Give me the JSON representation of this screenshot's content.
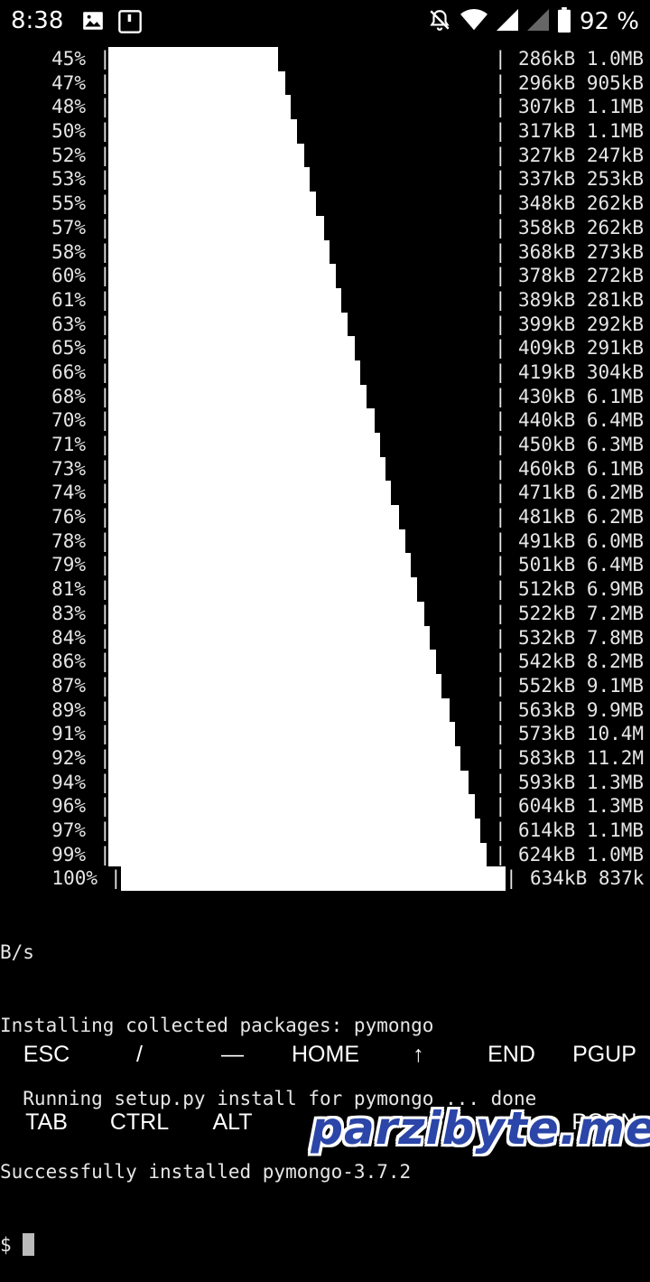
{
  "status_bar": {
    "time": "8:38",
    "left_icons": [
      "image-icon",
      "notification-square-icon"
    ],
    "right_icons": [
      "bell-off-icon",
      "wifi-icon",
      "signal-icon",
      "signal-icon-2",
      "battery-icon"
    ],
    "battery": "92 %"
  },
  "terminal": {
    "progress_rows": [
      {
        "pct": "45%",
        "fraction": 0.44,
        "stats": "286kB 1.0MB"
      },
      {
        "pct": "47%",
        "fraction": 0.458,
        "stats": "296kB 905kB"
      },
      {
        "pct": "48%",
        "fraction": 0.472,
        "stats": "307kB 1.1MB"
      },
      {
        "pct": "50%",
        "fraction": 0.488,
        "stats": "317kB 1.1MB"
      },
      {
        "pct": "52%",
        "fraction": 0.508,
        "stats": "327kB 247kB"
      },
      {
        "pct": "53%",
        "fraction": 0.522,
        "stats": "337kB 253kB"
      },
      {
        "pct": "55%",
        "fraction": 0.538,
        "stats": "348kB 262kB"
      },
      {
        "pct": "57%",
        "fraction": 0.558,
        "stats": "358kB 262kB"
      },
      {
        "pct": "58%",
        "fraction": 0.572,
        "stats": "368kB 273kB"
      },
      {
        "pct": "60%",
        "fraction": 0.588,
        "stats": "378kB 272kB"
      },
      {
        "pct": "61%",
        "fraction": 0.602,
        "stats": "389kB 281kB"
      },
      {
        "pct": "63%",
        "fraction": 0.618,
        "stats": "399kB 292kB"
      },
      {
        "pct": "65%",
        "fraction": 0.638,
        "stats": "409kB 291kB"
      },
      {
        "pct": "66%",
        "fraction": 0.652,
        "stats": "419kB 304kB"
      },
      {
        "pct": "68%",
        "fraction": 0.668,
        "stats": "430kB 6.1MB"
      },
      {
        "pct": "70%",
        "fraction": 0.688,
        "stats": "440kB 6.4MB"
      },
      {
        "pct": "71%",
        "fraction": 0.702,
        "stats": "450kB 6.3MB"
      },
      {
        "pct": "73%",
        "fraction": 0.718,
        "stats": "460kB 6.1MB"
      },
      {
        "pct": "74%",
        "fraction": 0.732,
        "stats": "471kB 6.2MB"
      },
      {
        "pct": "76%",
        "fraction": 0.752,
        "stats": "481kB 6.2MB"
      },
      {
        "pct": "78%",
        "fraction": 0.768,
        "stats": "491kB 6.0MB"
      },
      {
        "pct": "79%",
        "fraction": 0.782,
        "stats": "501kB 6.4MB"
      },
      {
        "pct": "81%",
        "fraction": 0.798,
        "stats": "512kB 6.9MB"
      },
      {
        "pct": "83%",
        "fraction": 0.818,
        "stats": "522kB 7.2MB"
      },
      {
        "pct": "84%",
        "fraction": 0.832,
        "stats": "532kB 7.8MB"
      },
      {
        "pct": "86%",
        "fraction": 0.848,
        "stats": "542kB 8.2MB"
      },
      {
        "pct": "87%",
        "fraction": 0.862,
        "stats": "552kB 9.1MB"
      },
      {
        "pct": "89%",
        "fraction": 0.882,
        "stats": "563kB 9.9MB"
      },
      {
        "pct": "91%",
        "fraction": 0.898,
        "stats": "573kB 10.4M"
      },
      {
        "pct": "92%",
        "fraction": 0.912,
        "stats": "583kB 11.2M"
      },
      {
        "pct": "94%",
        "fraction": 0.932,
        "stats": "593kB 1.3MB"
      },
      {
        "pct": "96%",
        "fraction": 0.948,
        "stats": "604kB 1.3MB"
      },
      {
        "pct": "97%",
        "fraction": 0.962,
        "stats": "614kB 1.1MB"
      },
      {
        "pct": "99%",
        "fraction": 0.978,
        "stats": "624kB 1.0MB"
      },
      {
        "pct": "100%",
        "fraction": 1.0,
        "stats": "634kB 837k"
      }
    ],
    "bar_char": "|",
    "lines": [
      "B/s",
      "Installing collected packages: pymongo",
      "  Running setup.py install for pymongo ... done",
      "Successfully installed pymongo-3.7.2"
    ],
    "prompt": "$ "
  },
  "extra_keys": {
    "row1": [
      "ESC",
      "/",
      "—",
      "HOME",
      "↑",
      "END",
      "PGUP"
    ],
    "row2": [
      "TAB",
      "CTRL",
      "ALT",
      "←",
      "↓",
      "→",
      "PGDN"
    ]
  },
  "watermark": "parzibyte.me"
}
